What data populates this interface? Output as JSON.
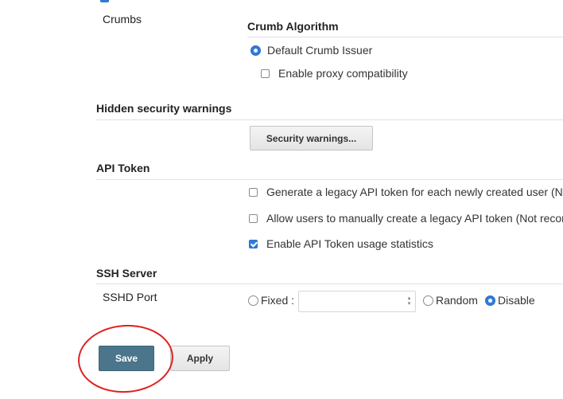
{
  "crumbs": {
    "row_label": "Crumbs",
    "algorithm_title": "Crumb Algorithm",
    "default_issuer_label": "Default Crumb Issuer",
    "proxy_compat_label": "Enable proxy compatibility",
    "default_issuer_selected": true,
    "proxy_compat_checked": false
  },
  "hidden_warnings": {
    "title": "Hidden security warnings",
    "button_label": "Security warnings..."
  },
  "api_token": {
    "title": "API Token",
    "options": [
      {
        "label": "Generate a legacy API token for each newly created user (N",
        "checked": false
      },
      {
        "label": "Allow users to manually create a legacy API token (Not recor",
        "checked": false
      },
      {
        "label": "Enable API Token usage statistics",
        "checked": true
      }
    ]
  },
  "ssh_server": {
    "title": "SSH Server",
    "row_label": "SSHD Port",
    "fixed_label": "Fixed :",
    "port_value": "",
    "random_label": "Random",
    "disable_label": "Disable",
    "selected": "Disable"
  },
  "actions": {
    "save_label": "Save",
    "apply_label": "Apply"
  },
  "colors": {
    "accent_blue": "#2f7bd9",
    "save_button": "#4b758b",
    "annotation": "#e02020"
  }
}
